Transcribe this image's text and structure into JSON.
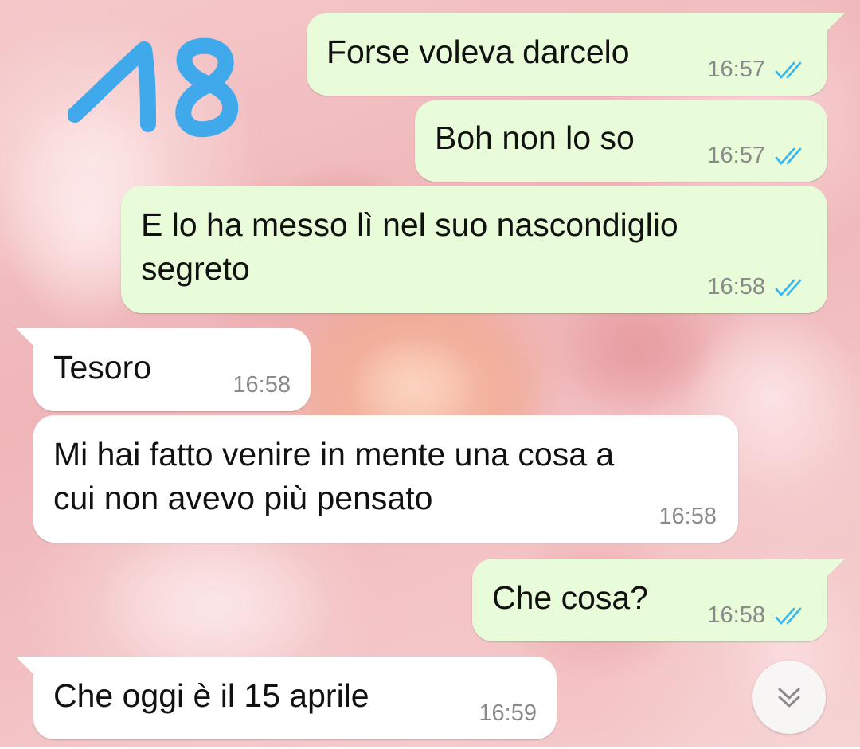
{
  "sticker": {
    "text": "18",
    "color": "#3fa9ec"
  },
  "colors": {
    "outgoing_bubble": "#e8fcd9",
    "incoming_bubble": "#ffffff",
    "read_ticks": "#34b7f1",
    "timestamp": "#8a8a8a"
  },
  "messages": [
    {
      "direction": "outgoing",
      "lines": [
        "Forse voleva darcelo"
      ],
      "time": "16:57",
      "status": "read"
    },
    {
      "direction": "outgoing",
      "lines": [
        "Boh non lo so"
      ],
      "time": "16:57",
      "status": "read"
    },
    {
      "direction": "outgoing",
      "lines": [
        "E lo ha messo lì nel suo nascondiglio",
        "segreto"
      ],
      "time": "16:58",
      "status": "read"
    },
    {
      "direction": "incoming",
      "lines": [
        "Tesoro"
      ],
      "time": "16:58"
    },
    {
      "direction": "incoming",
      "lines": [
        "Mi hai fatto venire in mente una cosa a",
        "cui non avevo più pensato"
      ],
      "time": "16:58"
    },
    {
      "direction": "outgoing",
      "lines": [
        "Che cosa?"
      ],
      "time": "16:58",
      "status": "read"
    },
    {
      "direction": "incoming",
      "lines": [
        "Che oggi è il 15 aprile"
      ],
      "time": "16:59"
    }
  ],
  "scroll_button": {
    "icon": "double-chevron-down-icon"
  }
}
